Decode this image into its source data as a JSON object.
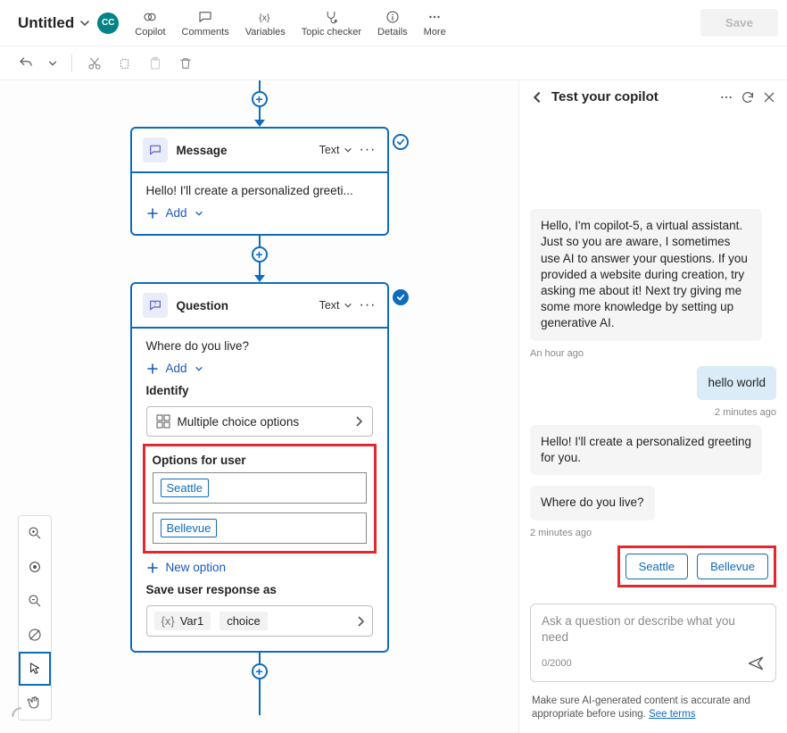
{
  "header": {
    "title": "Untitled",
    "presence_initials": "CC",
    "commands": {
      "copilot": "Copilot",
      "comments": "Comments",
      "variables": "Variables",
      "topic_checker": "Topic checker",
      "details": "Details",
      "more": "More"
    },
    "save_label": "Save"
  },
  "canvas": {
    "message_node": {
      "title": "Message",
      "type_label": "Text",
      "body": "Hello! I'll create a personalized greeti...",
      "add_label": "Add"
    },
    "question_node": {
      "title": "Question",
      "type_label": "Text",
      "prompt": "Where do you live?",
      "add_label": "Add",
      "identify_label": "Identify",
      "identify_value": "Multiple choice options",
      "options_label": "Options for user",
      "options": [
        "Seattle",
        "Bellevue"
      ],
      "new_option_label": "New option",
      "save_response_label": "Save user response as",
      "var_name": "Var1",
      "var_type": "choice"
    }
  },
  "panel": {
    "title": "Test your copilot",
    "messages": {
      "intro": "Hello, I'm copilot-5, a virtual assistant. Just so you are aware, I sometimes use AI to answer your questions. If you provided a website during creation, try asking me about it! Next try giving me some more knowledge by setting up generative AI.",
      "intro_ts": "An hour ago",
      "user1": "hello world",
      "user1_ts": "2 minutes ago",
      "bot2": "Hello! I'll create a personalized greeting for you.",
      "bot3": "Where do you live?",
      "bot3_ts": "2 minutes ago",
      "options": [
        "Seattle",
        "Bellevue"
      ]
    },
    "composer_placeholder": "Ask a question or describe what you need",
    "char_count": "0/2000",
    "disclaimer_text": "Make sure AI-generated content is accurate and appropriate before using. ",
    "disclaimer_link": "See terms"
  }
}
